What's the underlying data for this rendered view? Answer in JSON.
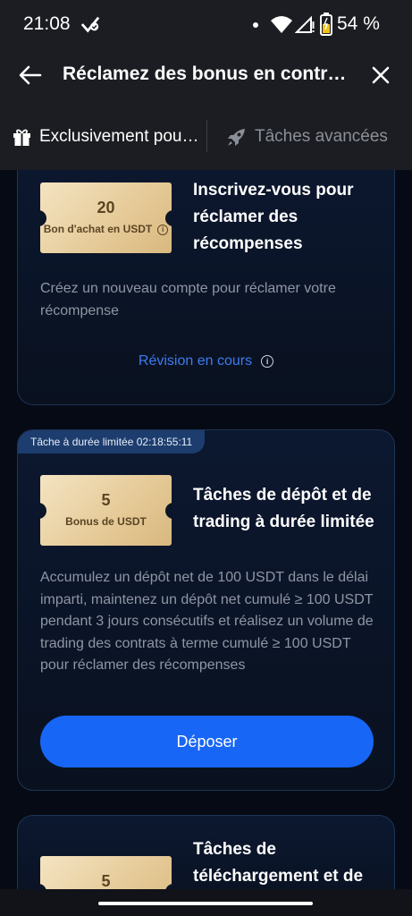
{
  "status_bar": {
    "time": "21:08",
    "battery_text": "54 %"
  },
  "header": {
    "title": "Réclamez des bonus en contrats"
  },
  "tabs": [
    {
      "label": "Exclusivement pour les nouveaux utilisateurs",
      "icon": "gift-icon",
      "active": true
    },
    {
      "label": "Tâches avancées",
      "icon": "rocket-icon",
      "active": false
    }
  ],
  "tasks": [
    {
      "reward_amount": "20",
      "reward_type": "Bon d'achat en USDT",
      "title": "Inscrivez-vous pour réclamer des récompenses",
      "description": "Créez un nouveau compte pour réclamer votre récompense",
      "status": "Révision en cours"
    },
    {
      "badge": "Tâche à durée limitée 02:18:55:11",
      "reward_amount": "5",
      "reward_type": "Bonus de USDT",
      "title": "Tâches de dépôt et de trading à durée limitée",
      "description": "Accumulez un dépôt net de 100 USDT dans le délai imparti, maintenez un dépôt net cumulé ≥ 100 USDT pendant 3 jours consécutifs et réalisez un volume de trading des contrats à terme cumulé ≥ 100 USDT pour réclamer des récompenses",
      "action": "Déposer"
    },
    {
      "reward_amount": "5",
      "title": "Tâches de téléchargement et de"
    }
  ],
  "colors": {
    "accent": "#1766f5",
    "link": "#3d7bf0",
    "background": "#050a14",
    "card": "#0c1830",
    "ticket": "#e5c996"
  }
}
